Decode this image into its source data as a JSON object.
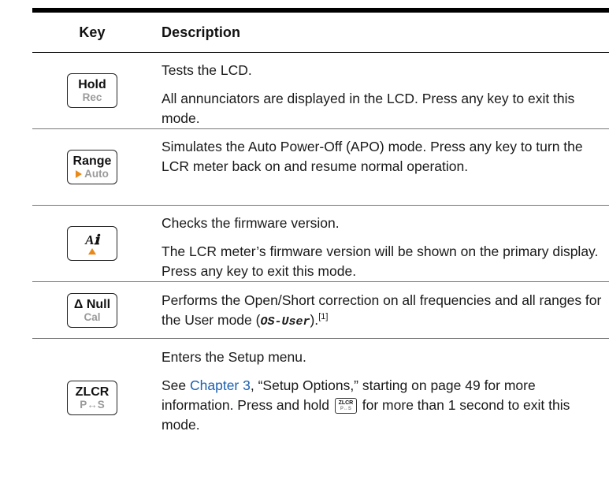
{
  "header": {
    "key_label": "Key",
    "description_label": "Description"
  },
  "rows": [
    {
      "key": {
        "top": "Hold",
        "bottom": "Rec",
        "icon": "none"
      },
      "paragraphs": [
        "Tests the LCD.",
        "All annunciators are displayed in the LCD. Press any key to exit this mode."
      ]
    },
    {
      "key": {
        "top": "Range",
        "bottom": "Auto",
        "icon": "arrow-right"
      },
      "paragraphs": [
        "Simulates the Auto Power-Off (APO) mode. Press any key to turn the LCR meter back on and resume normal operation."
      ]
    },
    {
      "key": {
        "top": "Aℹ",
        "bottom": "",
        "icon": "arrow-up"
      },
      "paragraphs": [
        "Checks the firmware version.",
        "The LCR meter’s firmware version will be shown on the primary display. Press any key to exit this mode."
      ]
    },
    {
      "key": {
        "top": "Δ Null",
        "bottom": "Cal",
        "icon": "none"
      },
      "paragraphs": [
        "Performs the Open/Short correction on all frequencies and all ranges for the User mode ("
      ],
      "os_user_text": "OS-User",
      "after_os_user": ").",
      "footnote": "[1]"
    },
    {
      "key": {
        "top": "ZLCR",
        "bottom": "P↔S",
        "icon": "none"
      },
      "paragraphs": [
        "Enters the Setup menu."
      ],
      "see_prefix": "See ",
      "chapter_link": "Chapter 3",
      "see_rest_1": ", “Setup Options,” starting on page 49 for more information. Press and hold ",
      "mini_key": {
        "top": "ZLCR",
        "bottom": "P↔S"
      },
      "see_rest_2": " for more than 1 second to exit this mode."
    }
  ],
  "colors": {
    "accent_arrow": "#e88a1a",
    "link": "#1b5fb0",
    "secondary_key_text": "#9a9a9a"
  }
}
